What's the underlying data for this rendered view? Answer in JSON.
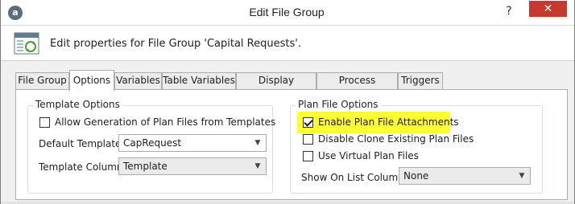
{
  "window": {
    "title": "Edit File Group",
    "app_icon_letter": "a",
    "help_label": "?",
    "close_label": "✕"
  },
  "header": {
    "text": "Edit properties for File Group 'Capital Requests'."
  },
  "tabs": [
    {
      "label": "File Group",
      "active": false
    },
    {
      "label": "Options",
      "active": true
    },
    {
      "label": "Variables",
      "active": false
    },
    {
      "label": "Table Variables",
      "active": false
    },
    {
      "label": "Display Columns",
      "active": false
    },
    {
      "label": "Process Columns",
      "active": false
    },
    {
      "label": "Triggers",
      "active": false
    }
  ],
  "template_options": {
    "title": "Template Options",
    "allow_generation": {
      "label": "Allow Generation of Plan Files from Templates",
      "checked": false
    },
    "default_template": {
      "label": "Default Template",
      "value": "CapRequest"
    },
    "template_column": {
      "label": "Template Column",
      "value": "Template"
    }
  },
  "plan_file_options": {
    "title": "Plan File Options",
    "enable_attachments": {
      "label": "Enable Plan File Attachments",
      "checked": true
    },
    "disable_clone": {
      "label": "Disable Clone Existing Plan Files",
      "checked": false
    },
    "use_virtual": {
      "label": "Use Virtual Plan Files",
      "checked": false
    },
    "show_on_list_column": {
      "label": "Show On List Column",
      "value": "None"
    }
  },
  "colors": {
    "highlight": "#ffff33",
    "close_button": "#c7382d"
  }
}
